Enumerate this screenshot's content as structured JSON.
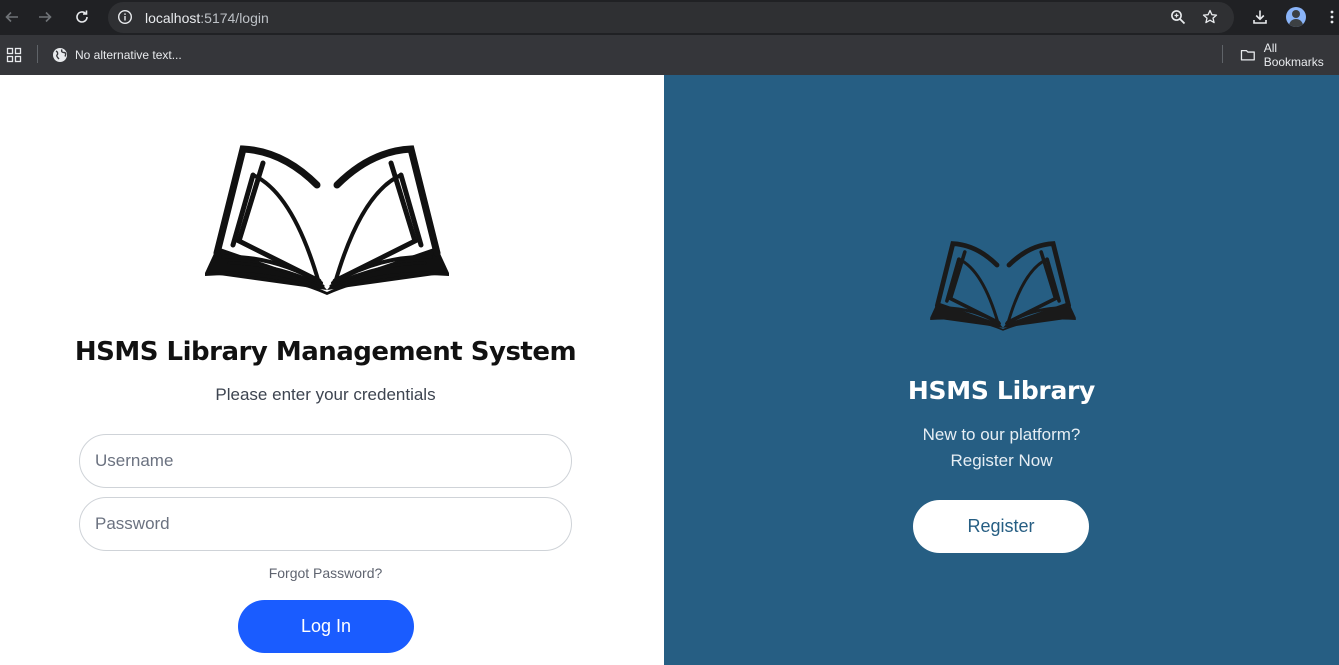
{
  "browser": {
    "url_host": "localhost",
    "url_path": ":5174/login",
    "bookmarks": {
      "item_label": "No alternative text...",
      "all_bookmarks_label": "All Bookmarks"
    }
  },
  "login": {
    "title": "HSMS Library Management System",
    "subtitle": "Please enter your credentials",
    "username_placeholder": "Username",
    "password_placeholder": "Password",
    "forgot_label": "Forgot Password?",
    "login_label": "Log In"
  },
  "side": {
    "title": "HSMS Library",
    "line1": "New to our platform?",
    "line2": "Register Now",
    "register_label": "Register"
  },
  "colors": {
    "side_bg": "#265e83",
    "login_button": "#1a5cff"
  },
  "icons": [
    "back-arrow-icon",
    "forward-arrow-icon",
    "reload-icon",
    "site-info-icon",
    "zoom-icon",
    "star-icon",
    "download-icon",
    "kebab-menu-icon",
    "apps-grid-icon",
    "globe-icon",
    "folder-icon",
    "open-book-logo"
  ]
}
